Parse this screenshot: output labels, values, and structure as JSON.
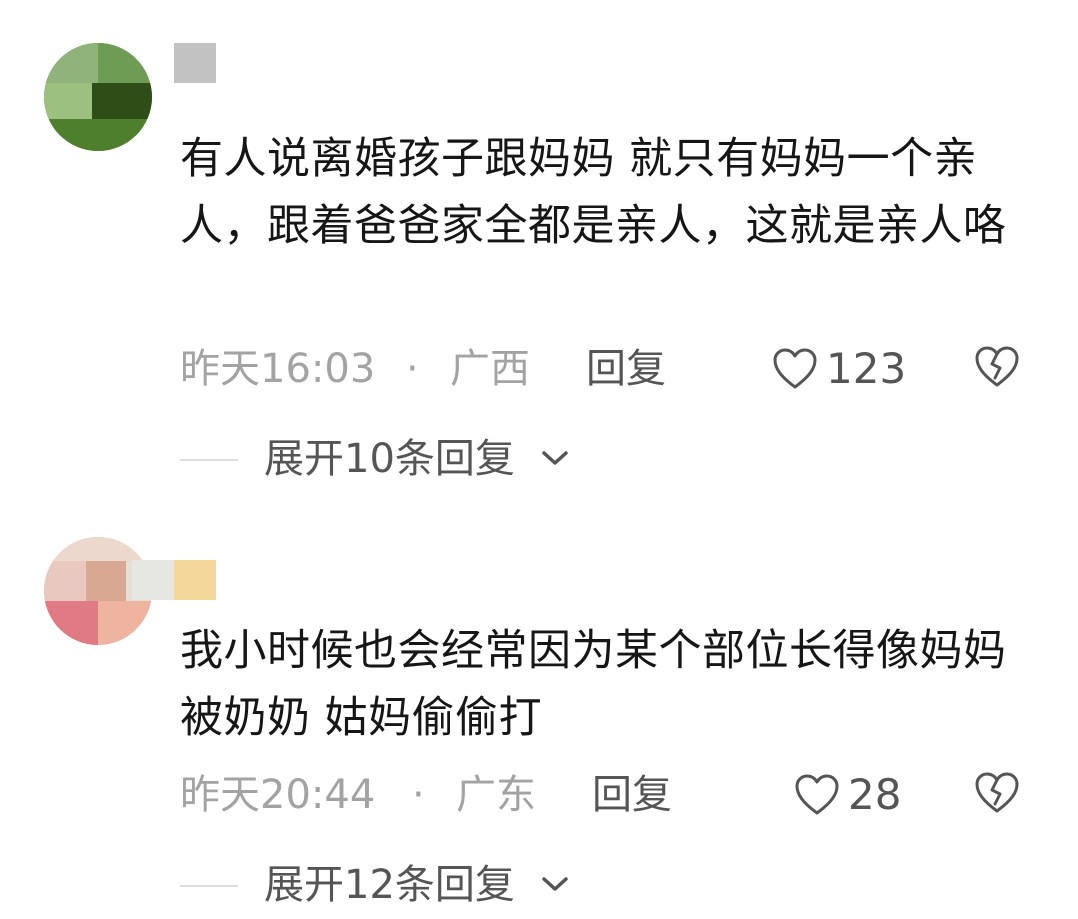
{
  "colors": {
    "text": "#161616",
    "meta": "#a3a3a3",
    "action": "#555555",
    "divider": "#dddddd"
  },
  "comments": [
    {
      "text": "有人说离婚孩子跟妈妈 就只有妈妈一个亲人，跟着爸爸家全都是亲人，这就是亲人咯",
      "time": "昨天16:03",
      "dot": "·",
      "region": "广西",
      "reply_label": "回复",
      "likes": "123",
      "expand_label": "展开10条回复",
      "icons": {
        "like": "heart-outline-icon",
        "dislike": "broken-heart-icon",
        "chevron": "chevron-down-icon"
      }
    },
    {
      "text": "我小时候也会经常因为某个部位长得像妈妈 被奶奶 姑妈偷偷打",
      "time": "昨天20:44",
      "dot": "·",
      "region": "广东",
      "reply_label": "回复",
      "likes": "28",
      "expand_label": "展开12条回复",
      "icons": {
        "like": "heart-outline-icon",
        "dislike": "broken-heart-icon",
        "chevron": "chevron-down-icon"
      }
    }
  ]
}
